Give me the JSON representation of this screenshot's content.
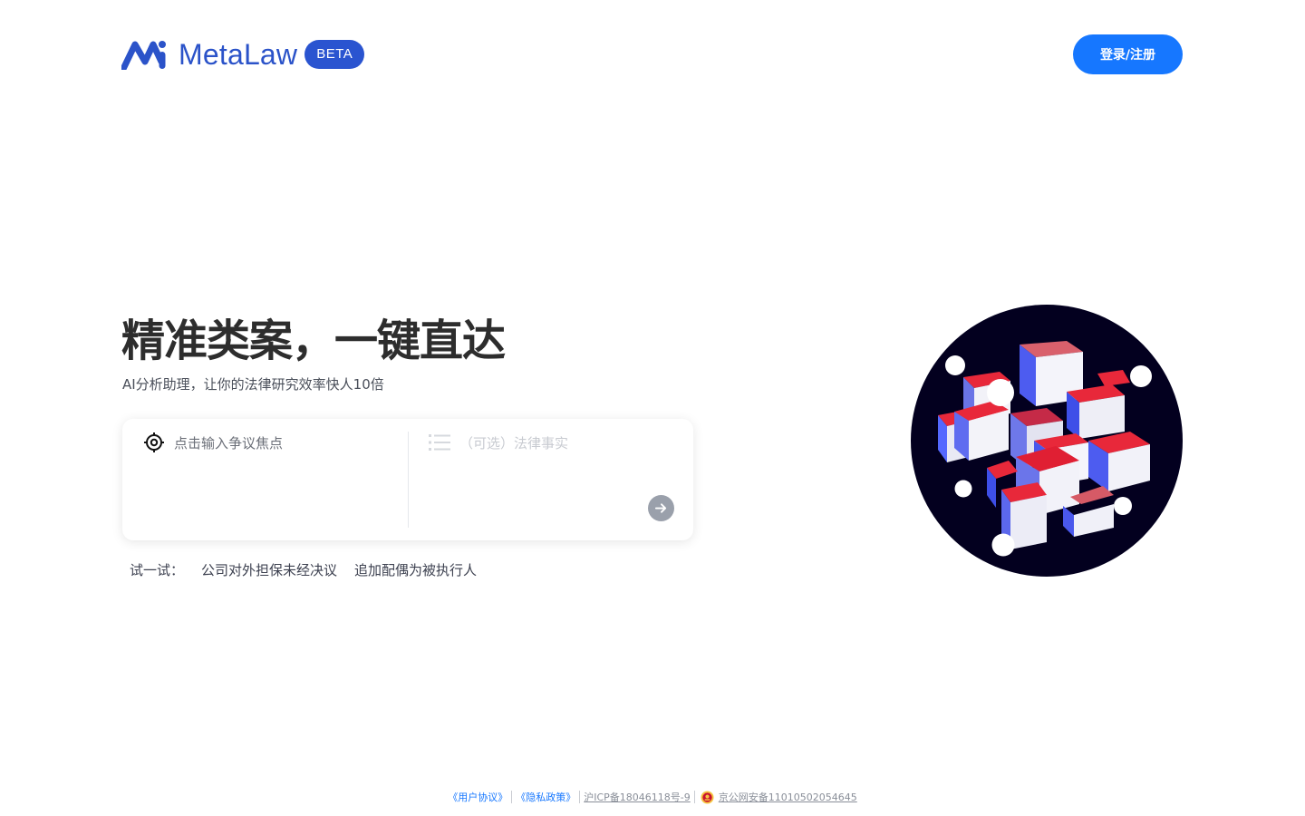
{
  "header": {
    "brand": "MetaLaw",
    "badge": "BETA",
    "login_label": "登录/注册",
    "brand_color": "#2b53c9",
    "accent_color": "#1677ff"
  },
  "hero": {
    "title": "精准类案，一键直达",
    "subtitle": "AI分析助理，让你的法律研究效率快人10倍"
  },
  "search": {
    "focus_placeholder": "点击输入争议焦点",
    "facts_placeholder": "（可选）法律事实",
    "focus_icon": "target-icon",
    "facts_icon": "list-icon",
    "submit_icon": "arrow-right-icon"
  },
  "try": {
    "label": "试一试：",
    "items": [
      "公司对外担保未经决议",
      "追加配偶为被执行人"
    ]
  },
  "illustration": {
    "background_color": "#03001f",
    "cube_colors": [
      "#ffffff",
      "#5468ff",
      "#e8283a"
    ]
  },
  "footer": {
    "user_agreement": "《用户协议》",
    "privacy_policy": "《隐私政策》",
    "icp": "沪ICP备18046118号-9",
    "police_record": "京公网安备11010502054645"
  }
}
